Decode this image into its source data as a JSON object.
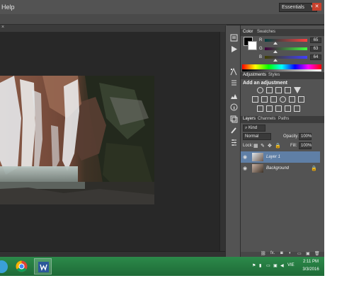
{
  "menubar": {
    "help_label": "Help"
  },
  "workspace": {
    "selected": "Essentials"
  },
  "color_panel": {
    "tabs": [
      "Color",
      "Swatches"
    ],
    "channels": [
      {
        "label": "R",
        "value": "65",
        "level": 0.25
      },
      {
        "label": "G",
        "value": "63",
        "level": 0.25
      },
      {
        "label": "B",
        "value": "64",
        "level": 0.25
      }
    ]
  },
  "adjustments_panel": {
    "tabs": [
      "Adjustments",
      "Styles"
    ],
    "title": "Add an adjustment"
  },
  "layers_panel": {
    "tabs": [
      "Layers",
      "Channels",
      "Paths"
    ],
    "filter": "Kind",
    "blend_mode": "Normal",
    "opacity_label": "Opacity:",
    "opacity_value": "100%",
    "lock_label": "Lock:",
    "fill_label": "Fill:",
    "fill_value": "100%",
    "layers": [
      {
        "name": "Layer 1",
        "selected": true
      },
      {
        "name": "Background",
        "selected": false
      }
    ],
    "footer_fx": "fx."
  },
  "taskbar": {
    "language": "VIE",
    "time": "2:11 PM",
    "date": "3/3/2016"
  },
  "colors": {
    "accent_selected": "#5f7fa6",
    "taskbar": "#1e6a37"
  }
}
